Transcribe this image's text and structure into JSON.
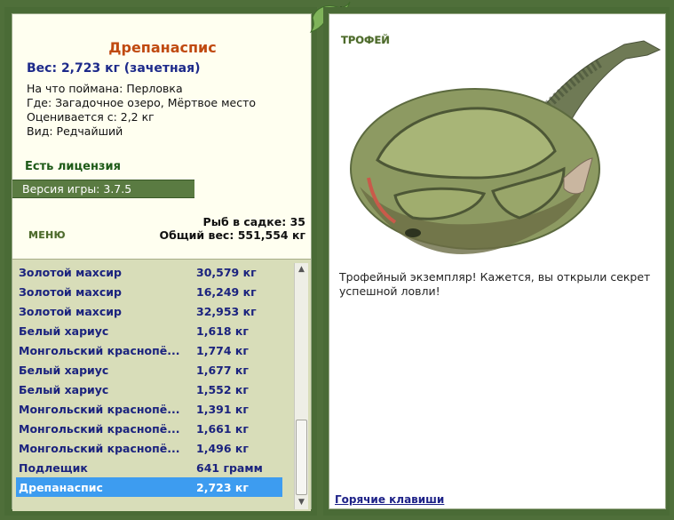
{
  "fish": {
    "name": "Дрепанаспис",
    "weight_line": "Вес: 2,723 кг (зачетная)",
    "bait": "На что поймана: Перловка",
    "location": "Где: Загадочное озеро, Мёртвое место",
    "value": "Оценивается с: 2,2 кг",
    "kind": "Вид: Редчайший"
  },
  "license": "Есть лицензия",
  "version": "Версия игры: 3.7.5",
  "menu_label": "МЕНЮ",
  "keepnet": {
    "count": "Рыб в садке: 35",
    "total": "Общий вес: 551,554 кг"
  },
  "catch_list": [
    {
      "name": "Золотой махсир",
      "weight": "30,579 кг"
    },
    {
      "name": "Золотой махсир",
      "weight": "16,249 кг"
    },
    {
      "name": "Золотой махсир",
      "weight": "32,953 кг"
    },
    {
      "name": "Белый хариус",
      "weight": "1,618 кг"
    },
    {
      "name": "Монгольский красноперка",
      "display": "Монгольский краснопё...",
      "weight": "1,774 кг"
    },
    {
      "name": "Белый хариус",
      "weight": "1,677 кг"
    },
    {
      "name": "Белый хариус",
      "weight": "1,552 кг"
    },
    {
      "name": "Монгольский краснопё...",
      "weight": "1,391 кг"
    },
    {
      "name": "Монгольский краснопё...",
      "weight": "1,661 кг"
    },
    {
      "name": "Монгольский краснопё...",
      "weight": "1,496 кг"
    },
    {
      "name": "Подлещик",
      "weight": "641 грамм"
    },
    {
      "name": "Дрепанаспис",
      "weight": "2,723 кг",
      "selected": true
    }
  ],
  "trophy": {
    "label": "ТРОФЕЙ",
    "text": "Трофейный экземпляр! Кажется, вы открыли секрет успешной ловли!"
  },
  "hotkeys": "Горячие клавиши",
  "colors": {
    "frame": "#4a6b36",
    "list_bg": "#d8ddb9",
    "selection": "#3d9cf0",
    "fish_name": "#c04a10",
    "list_text": "#1b237e"
  }
}
